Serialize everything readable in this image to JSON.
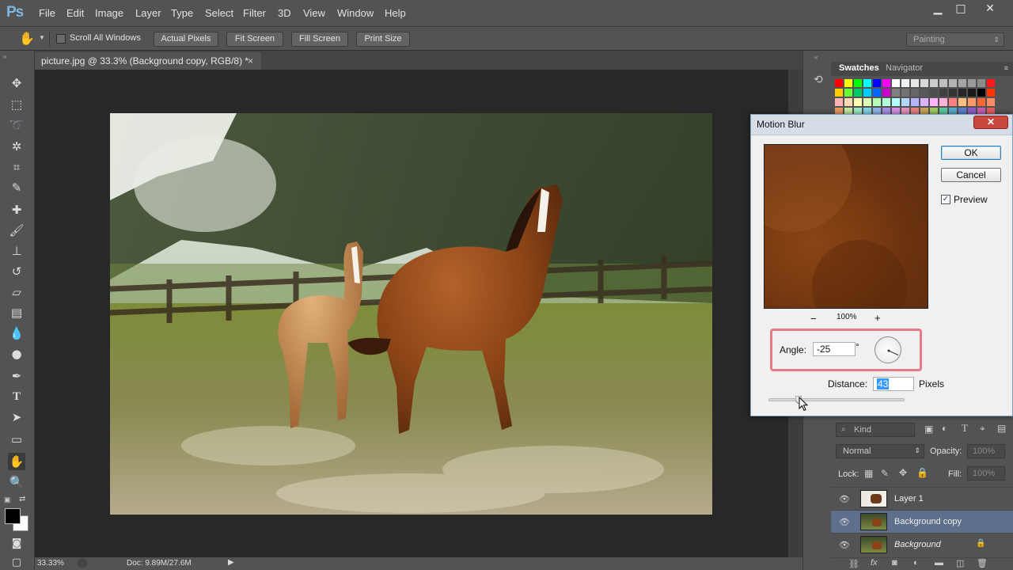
{
  "app": {
    "logo": "Ps"
  },
  "menu": [
    "File",
    "Edit",
    "Image",
    "Layer",
    "Type",
    "Select",
    "Filter",
    "3D",
    "View",
    "Window",
    "Help"
  ],
  "window_controls": {
    "minimize": "▁",
    "maximize": "□",
    "close": "✕"
  },
  "options": {
    "scroll_all_windows": "Scroll All Windows",
    "actual_pixels": "Actual Pixels",
    "fit_screen": "Fit Screen",
    "fill_screen": "Fill Screen",
    "print_size": "Print Size",
    "workspace": "Painting"
  },
  "document": {
    "tab_title": "picture.jpg @ 33.3% (Background copy, RGB/8) *",
    "close_glyph": "×"
  },
  "status": {
    "zoom": "33.33%",
    "doc": "Doc: 9.89M/27.6M"
  },
  "panels": {
    "swatches_tab": "Swatches",
    "navigator_tab": "Navigator",
    "swatch_rows": [
      [
        "#ff0000",
        "#ffff00",
        "#00ff00",
        "#00ffff",
        "#0000ff",
        "#ff00ff",
        "#ffffff",
        "#f2f2f2",
        "#e6e6e6",
        "#d9d9d9",
        "#cccccc",
        "#bfbfbf",
        "#b3b3b3",
        "#a6a6a6",
        "#999999",
        "#8c8c8c",
        "#ff1a1a"
      ],
      [
        "#ffcc00",
        "#66ff33",
        "#00cc66",
        "#00ccff",
        "#0066ff",
        "#cc00cc",
        "#808080",
        "#737373",
        "#666666",
        "#595959",
        "#4d4d4d",
        "#404040",
        "#333333",
        "#262626",
        "#1a1a1a",
        "#000000",
        "#ff3300"
      ],
      [
        "#ffb3b3",
        "#ffd9b3",
        "#ffffb3",
        "#d9ffb3",
        "#b3ffb3",
        "#b3ffd9",
        "#b3ffff",
        "#b3d9ff",
        "#b3b3ff",
        "#d9b3ff",
        "#ffb3ff",
        "#ffb3d9",
        "#ff8080",
        "#ffbf80",
        "#ff9966",
        "#ff6633",
        "#ff8c66"
      ],
      [
        "#e6995c",
        "#c2e6a0",
        "#9ce6c2",
        "#80d4e6",
        "#8fb3e6",
        "#a68fe6",
        "#d48fe6",
        "#e68fbf",
        "#e68080",
        "#c9a35c",
        "#9ec95c",
        "#5cc99e",
        "#5ca9c9",
        "#5c7ec9",
        "#8b5cc9",
        "#c95cb0",
        "#e05c5c"
      ]
    ],
    "kind_label": "Kind",
    "blend_mode": "Normal",
    "opacity_label": "Opacity:",
    "opacity_value": "100%",
    "lock_label": "Lock:",
    "fill_label": "Fill:",
    "fill_value": "100%",
    "layers": [
      {
        "name": "Layer 1",
        "selected": false,
        "italic": false,
        "locked": false
      },
      {
        "name": "Background copy",
        "selected": true,
        "italic": false,
        "locked": false
      },
      {
        "name": "Background",
        "selected": false,
        "italic": true,
        "locked": true
      }
    ]
  },
  "motion_blur": {
    "title": "Motion Blur",
    "ok": "OK",
    "cancel": "Cancel",
    "preview_label": "Preview",
    "preview_checked": true,
    "zoom": "100%",
    "zoom_out": "−",
    "zoom_in": "+",
    "angle_label": "Angle:",
    "angle_value": "-25",
    "degree_symbol": "°",
    "distance_label": "Distance:",
    "distance_value": "43",
    "distance_unit": "Pixels"
  }
}
